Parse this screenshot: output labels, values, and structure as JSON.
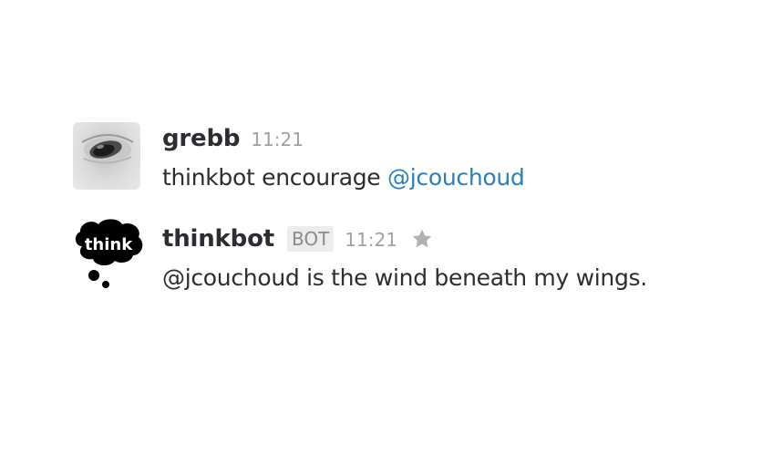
{
  "messages": [
    {
      "username": "grebb",
      "timestamp": "11:21",
      "text_prefix": "thinkbot encourage ",
      "mention": "@jcouchoud",
      "avatar_icon": "eye-photo-avatar"
    },
    {
      "username": "thinkbot",
      "badge": "BOT",
      "timestamp": "11:21",
      "text": "@jcouchoud is the wind beneath my wings.",
      "avatar_icon": "think-bubble-avatar",
      "avatar_text": "think",
      "star_icon": "star-icon"
    }
  ],
  "colors": {
    "mention": "#2a80b9",
    "timestamp": "#a0a0a2",
    "text": "#2c2d30",
    "star": "#b0b0b0"
  }
}
